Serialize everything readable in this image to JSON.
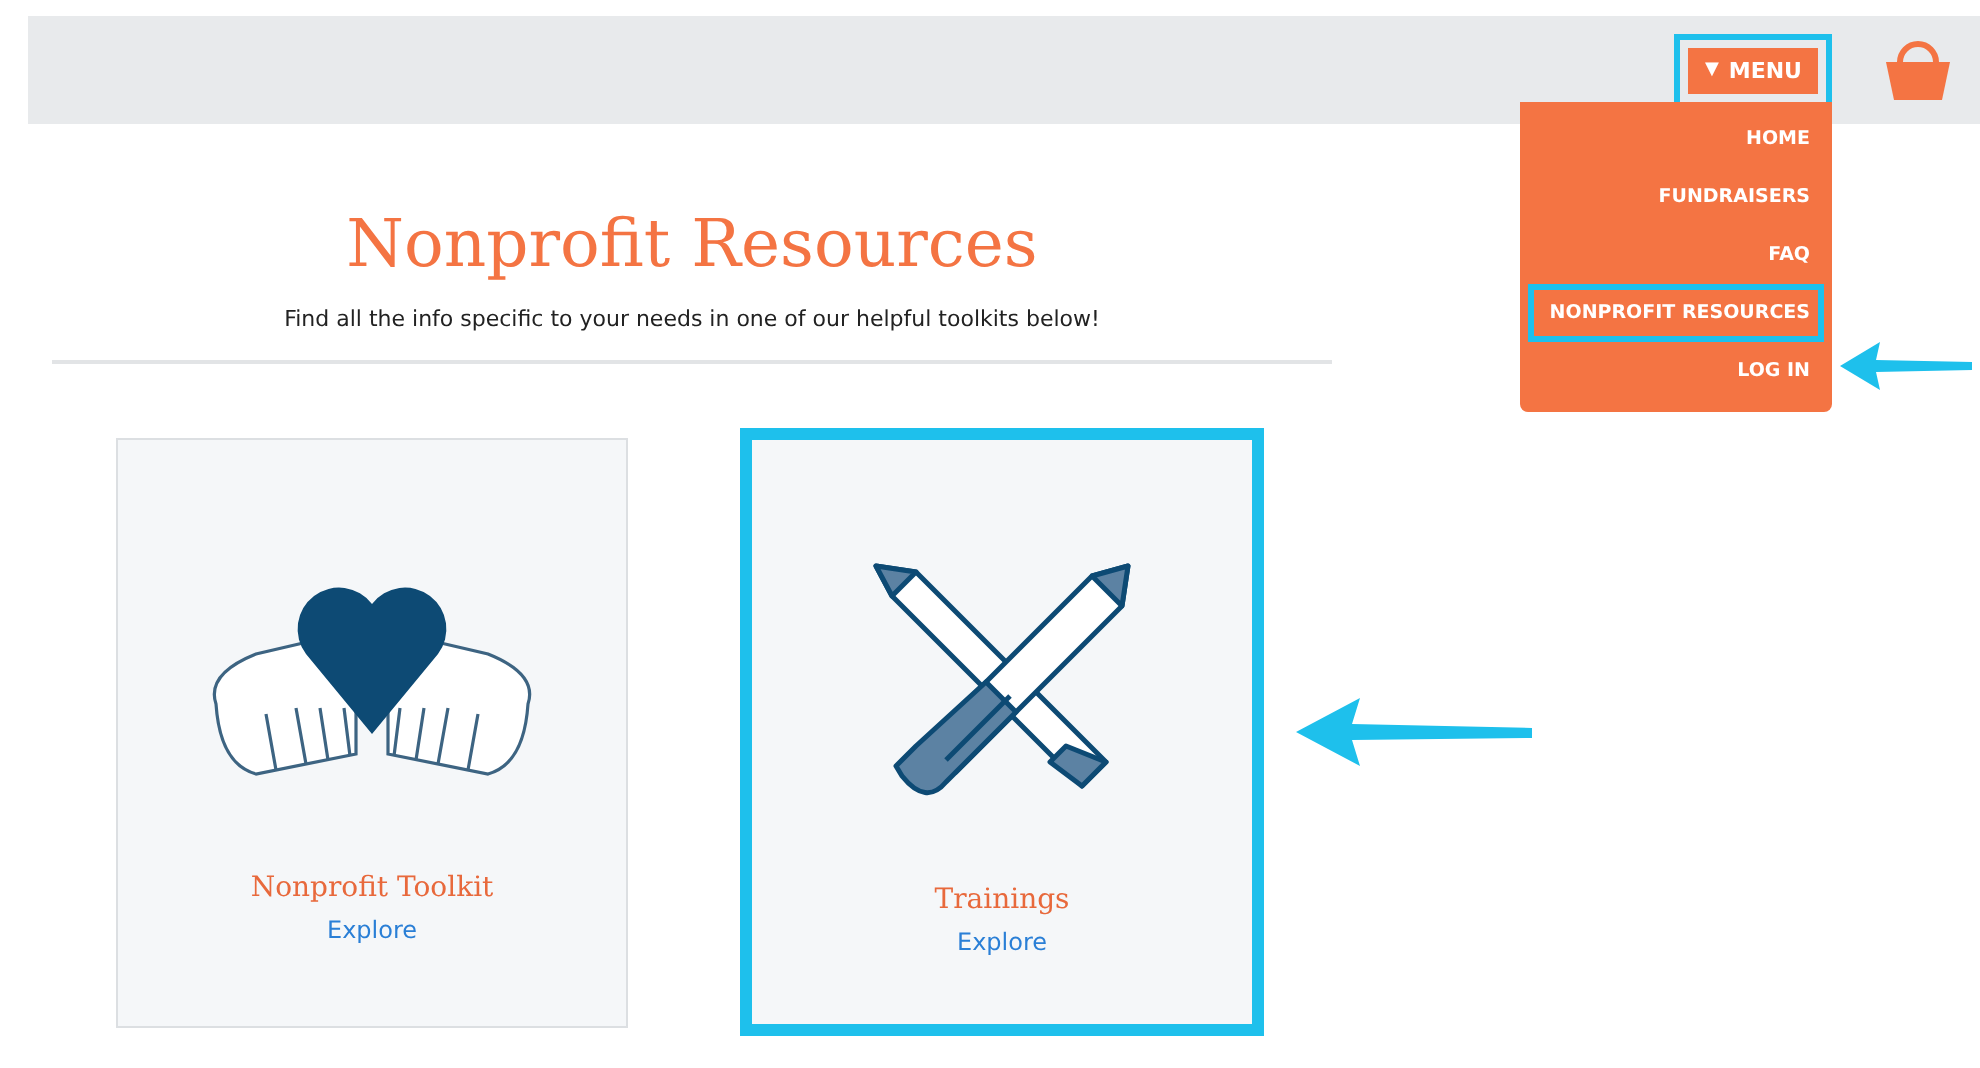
{
  "header": {
    "menu_button": {
      "caret": "▼",
      "label": "MENU",
      "highlighted": true
    }
  },
  "menu": {
    "items": [
      {
        "label": "HOME",
        "highlighted": false
      },
      {
        "label": "FUNDRAISERS",
        "highlighted": false
      },
      {
        "label": "FAQ",
        "highlighted": false
      },
      {
        "label": "NONPROFIT RESOURCES",
        "highlighted": true
      },
      {
        "label": "LOG IN",
        "highlighted": false
      }
    ]
  },
  "page": {
    "title": "Nonprofit Resources",
    "subtitle": "Find all the info specific to your needs in one of our helpful toolkits below!"
  },
  "cards": [
    {
      "kind": "hands",
      "title": "Nonprofit Toolkit",
      "link": "Explore",
      "highlighted": false
    },
    {
      "kind": "pencils",
      "title": "Trainings",
      "link": "Explore",
      "highlighted": true
    }
  ]
}
